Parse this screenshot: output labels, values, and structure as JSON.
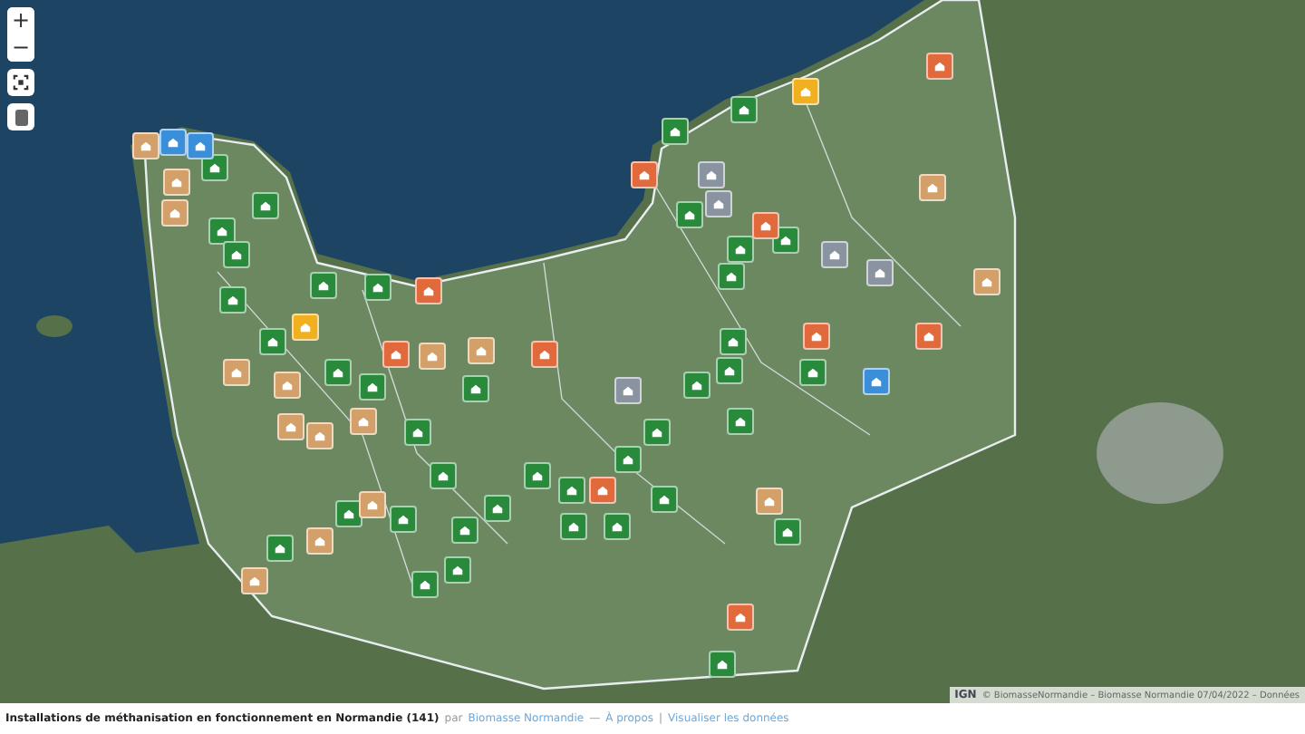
{
  "map": {
    "zoom_controls": {
      "zoom_in": "+",
      "zoom_out": "−"
    },
    "markers": [
      {
        "color": "#2a8a3c"
      },
      {
        "color": "#2a8a3c"
      },
      {
        "color": "#2a8a3c"
      },
      {
        "color": "#2a8a3c"
      },
      {
        "color": "#2a8a3c"
      },
      {
        "color": "#2a8a3c"
      },
      {
        "color": "#2a8a3c"
      },
      {
        "color": "#2a8a3c"
      },
      {
        "color": "#2a8a3c"
      },
      {
        "color": "#2a8a3c"
      },
      {
        "color": "#2a8a3c"
      },
      {
        "color": "#2a8a3c"
      },
      {
        "color": "#2a8a3c"
      },
      {
        "color": "#2a8a3c"
      },
      {
        "color": "#2a8a3c"
      },
      {
        "color": "#2a8a3c"
      },
      {
        "color": "#2a8a3c"
      },
      {
        "color": "#2a8a3c"
      },
      {
        "color": "#2a8a3c"
      },
      {
        "color": "#2a8a3c"
      },
      {
        "color": "#2a8a3c"
      },
      {
        "color": "#2a8a3c"
      },
      {
        "color": "#2a8a3c"
      },
      {
        "color": "#2a8a3c"
      },
      {
        "color": "#2a8a3c"
      },
      {
        "color": "#2a8a3c"
      },
      {
        "color": "#2a8a3c"
      },
      {
        "color": "#2a8a3c"
      },
      {
        "color": "#2a8a3c"
      },
      {
        "color": "#2a8a3c"
      },
      {
        "color": "#2a8a3c"
      },
      {
        "color": "#2a8a3c"
      },
      {
        "color": "#2a8a3c"
      },
      {
        "color": "#2a8a3c"
      },
      {
        "color": "#2a8a3c"
      },
      {
        "color": "#2a8a3c"
      },
      {
        "color": "#2a8a3c"
      },
      {
        "color": "#2a8a3c"
      },
      {
        "color": "#2a8a3c"
      },
      {
        "color": "#2a8a3c"
      },
      {
        "color": "#d4a06a"
      },
      {
        "color": "#d4a06a"
      },
      {
        "color": "#d4a06a"
      },
      {
        "color": "#d4a06a"
      },
      {
        "color": "#d4a06a"
      },
      {
        "color": "#d4a06a"
      },
      {
        "color": "#d4a06a"
      },
      {
        "color": "#d4a06a"
      },
      {
        "color": "#d4a06a"
      },
      {
        "color": "#d4a06a"
      },
      {
        "color": "#d4a06a"
      },
      {
        "color": "#d4a06a"
      },
      {
        "color": "#d4a06a"
      },
      {
        "color": "#d4a06a"
      },
      {
        "color": "#d4a06a"
      },
      {
        "color": "#d4a06a"
      },
      {
        "color": "#e06a3c"
      },
      {
        "color": "#e06a3c"
      },
      {
        "color": "#e06a3c"
      },
      {
        "color": "#e06a3c"
      },
      {
        "color": "#e06a3c"
      },
      {
        "color": "#e06a3c"
      },
      {
        "color": "#e06a3c"
      },
      {
        "color": "#e06a3c"
      },
      {
        "color": "#e06a3c"
      },
      {
        "color": "#e06a3c"
      },
      {
        "color": "#3a8fd8"
      },
      {
        "color": "#3a8fd8"
      },
      {
        "color": "#3a8fd8"
      },
      {
        "color": "#f0b020"
      },
      {
        "color": "#f0b020"
      },
      {
        "color": "#8a93a0"
      },
      {
        "color": "#8a93a0"
      },
      {
        "color": "#8a93a0"
      },
      {
        "color": "#8a93a0"
      },
      {
        "color": "#8a93a0"
      }
    ],
    "attribution": {
      "logo": "IGN",
      "text": "© BiomasseNormandie – Biomasse Normandie 07/04/2022 – Données"
    }
  },
  "footer": {
    "title": "Installations de méthanisation en fonctionnement en Normandie (141)",
    "by": "par",
    "author_link": "Biomasse Normandie",
    "separator": "—",
    "about_link": "À propos",
    "divider": "|",
    "data_link": "Visualiser les données"
  }
}
